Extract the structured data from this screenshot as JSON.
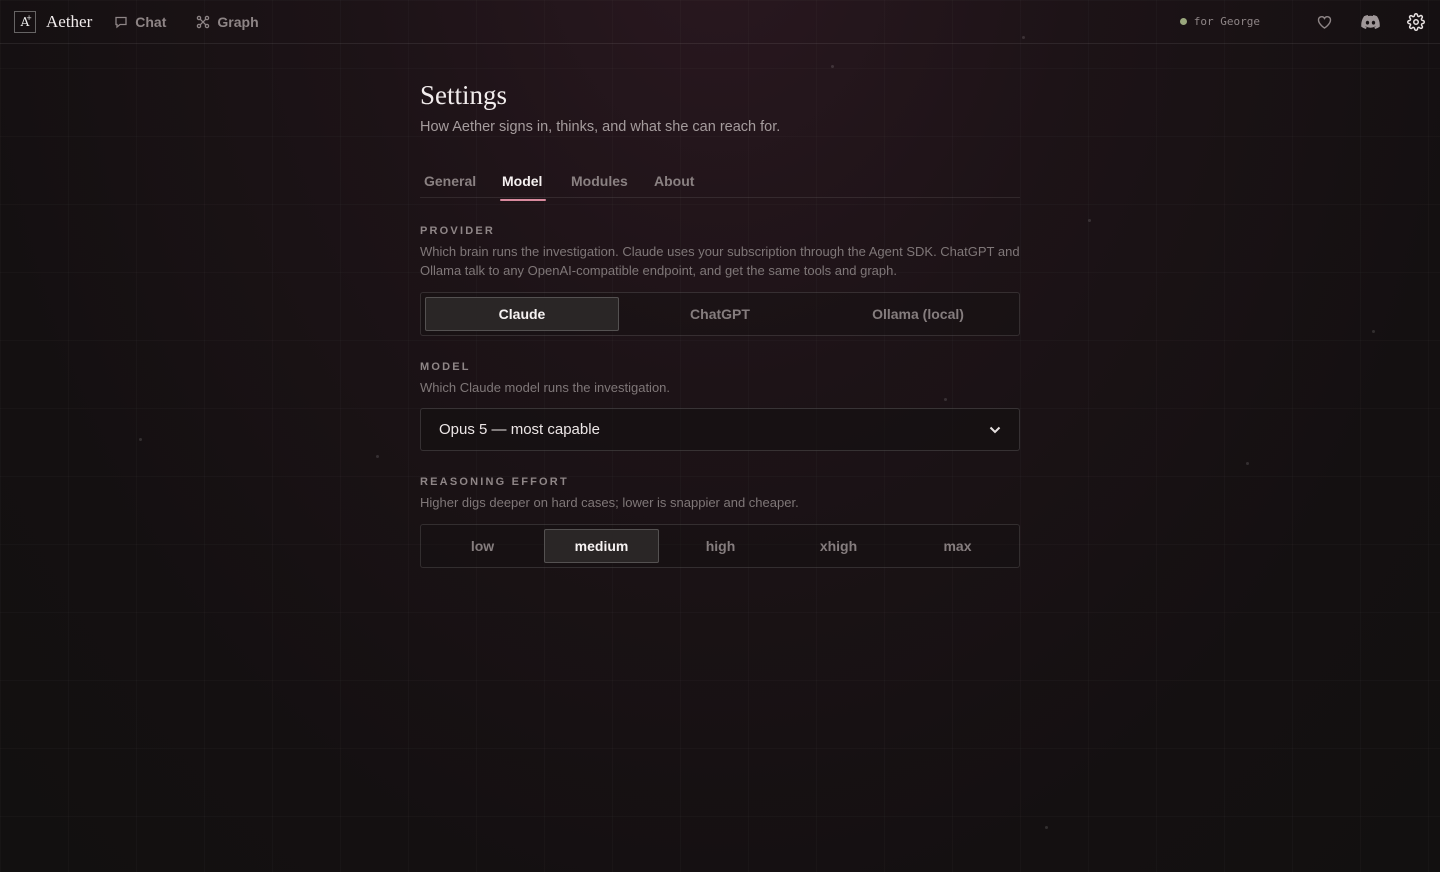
{
  "app": {
    "name": "Aether",
    "logo_letter": "A"
  },
  "nav": [
    {
      "label": "Chat",
      "icon": "chat-bubble-icon"
    },
    {
      "label": "Graph",
      "icon": "graph-icon"
    }
  ],
  "user": {
    "label": "for George",
    "status_color": "#9aa77d"
  },
  "header_icons": [
    "heart-icon",
    "discord-icon",
    "gear-icon"
  ],
  "page": {
    "title": "Settings",
    "subtitle": "How Aether signs in, thinks, and what she can reach for."
  },
  "tabs": [
    {
      "label": "General",
      "active": false
    },
    {
      "label": "Model",
      "active": true
    },
    {
      "label": "Modules",
      "active": false
    },
    {
      "label": "About",
      "active": false
    }
  ],
  "provider": {
    "label": "PROVIDER",
    "description": "Which brain runs the investigation. Claude uses your subscription through the Agent SDK. ChatGPT and Ollama talk to any OpenAI-compatible endpoint, and get the same tools and graph.",
    "options": [
      "Claude",
      "ChatGPT",
      "Ollama (local)"
    ],
    "selected": "Claude"
  },
  "model": {
    "label": "MODEL",
    "description": "Which Claude model runs the investigation.",
    "selected": "Opus 5 — most capable"
  },
  "reasoning": {
    "label": "REASONING EFFORT",
    "description": "Higher digs deeper on hard cases; lower is snappier and cheaper.",
    "options": [
      "low",
      "medium",
      "high",
      "xhigh",
      "max"
    ],
    "selected": "medium"
  },
  "colors": {
    "accent": "#d98a9e",
    "background": "#1a1214"
  }
}
